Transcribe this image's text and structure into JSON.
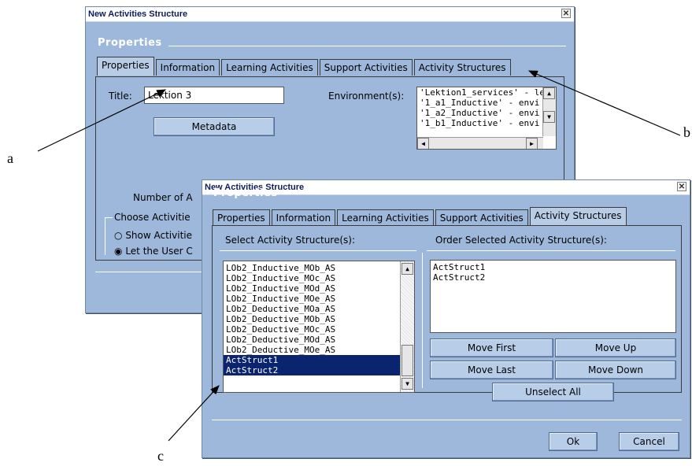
{
  "back_window": {
    "title": "New Activities Structure",
    "close": "✕",
    "section": "Properties",
    "tabs": [
      "Properties",
      "Information",
      "Learning Activities",
      "Support Activities",
      "Activity Structures"
    ],
    "title_label": "Title:",
    "title_value": "Lektion 3",
    "metadata_button": "Metadata",
    "environments_label": "Environment(s):",
    "environments": [
      "'Lektion1_services' - le",
      "'1_a1_Inductive' - envi",
      "'1_a2_Inductive' - envi",
      "'1_b1_Inductive' - envi"
    ],
    "number_label": "Number of A",
    "choose_label": "Choose Activitie",
    "radio1": "Show Activitie",
    "radio2": "Let the User C"
  },
  "front_window": {
    "title": "New Activities Structure",
    "close": "✕",
    "section": "Properties",
    "tabs": [
      "Properties",
      "Information",
      "Learning Activities",
      "Support Activities",
      "Activity Structures"
    ],
    "select_label": "Select Activity Structure(s):",
    "order_label": "Order Selected Activity Structure(s):",
    "select_items": [
      "LOb2_Inductive_MOb_AS",
      "LOb2_Inductive_MOc_AS",
      "LOb2_Inductive_MOd_AS",
      "LOb2_Inductive_MOe_AS",
      "LOb2_Deductive_MOa_AS",
      "LOb2_Deductive_MOb_AS",
      "LOb2_Deductive_MOc_AS",
      "LOb2_Deductive_MOd_AS",
      "LOb2_Deductive_MOe_AS",
      "ActStruct1",
      "ActStruct2"
    ],
    "order_items": [
      "ActStruct1",
      "ActStruct2"
    ],
    "move_first": "Move First",
    "move_up": "Move Up",
    "move_last": "Move Last",
    "move_down": "Move Down",
    "unselect_all": "Unselect All",
    "ok": "Ok",
    "cancel": "Cancel"
  },
  "annotations": {
    "a": "a",
    "b": "b",
    "c": "c"
  },
  "colors": {
    "window_bg": "#9db8da",
    "selection": "#0a2470",
    "title_text": "#0b1f5c"
  }
}
